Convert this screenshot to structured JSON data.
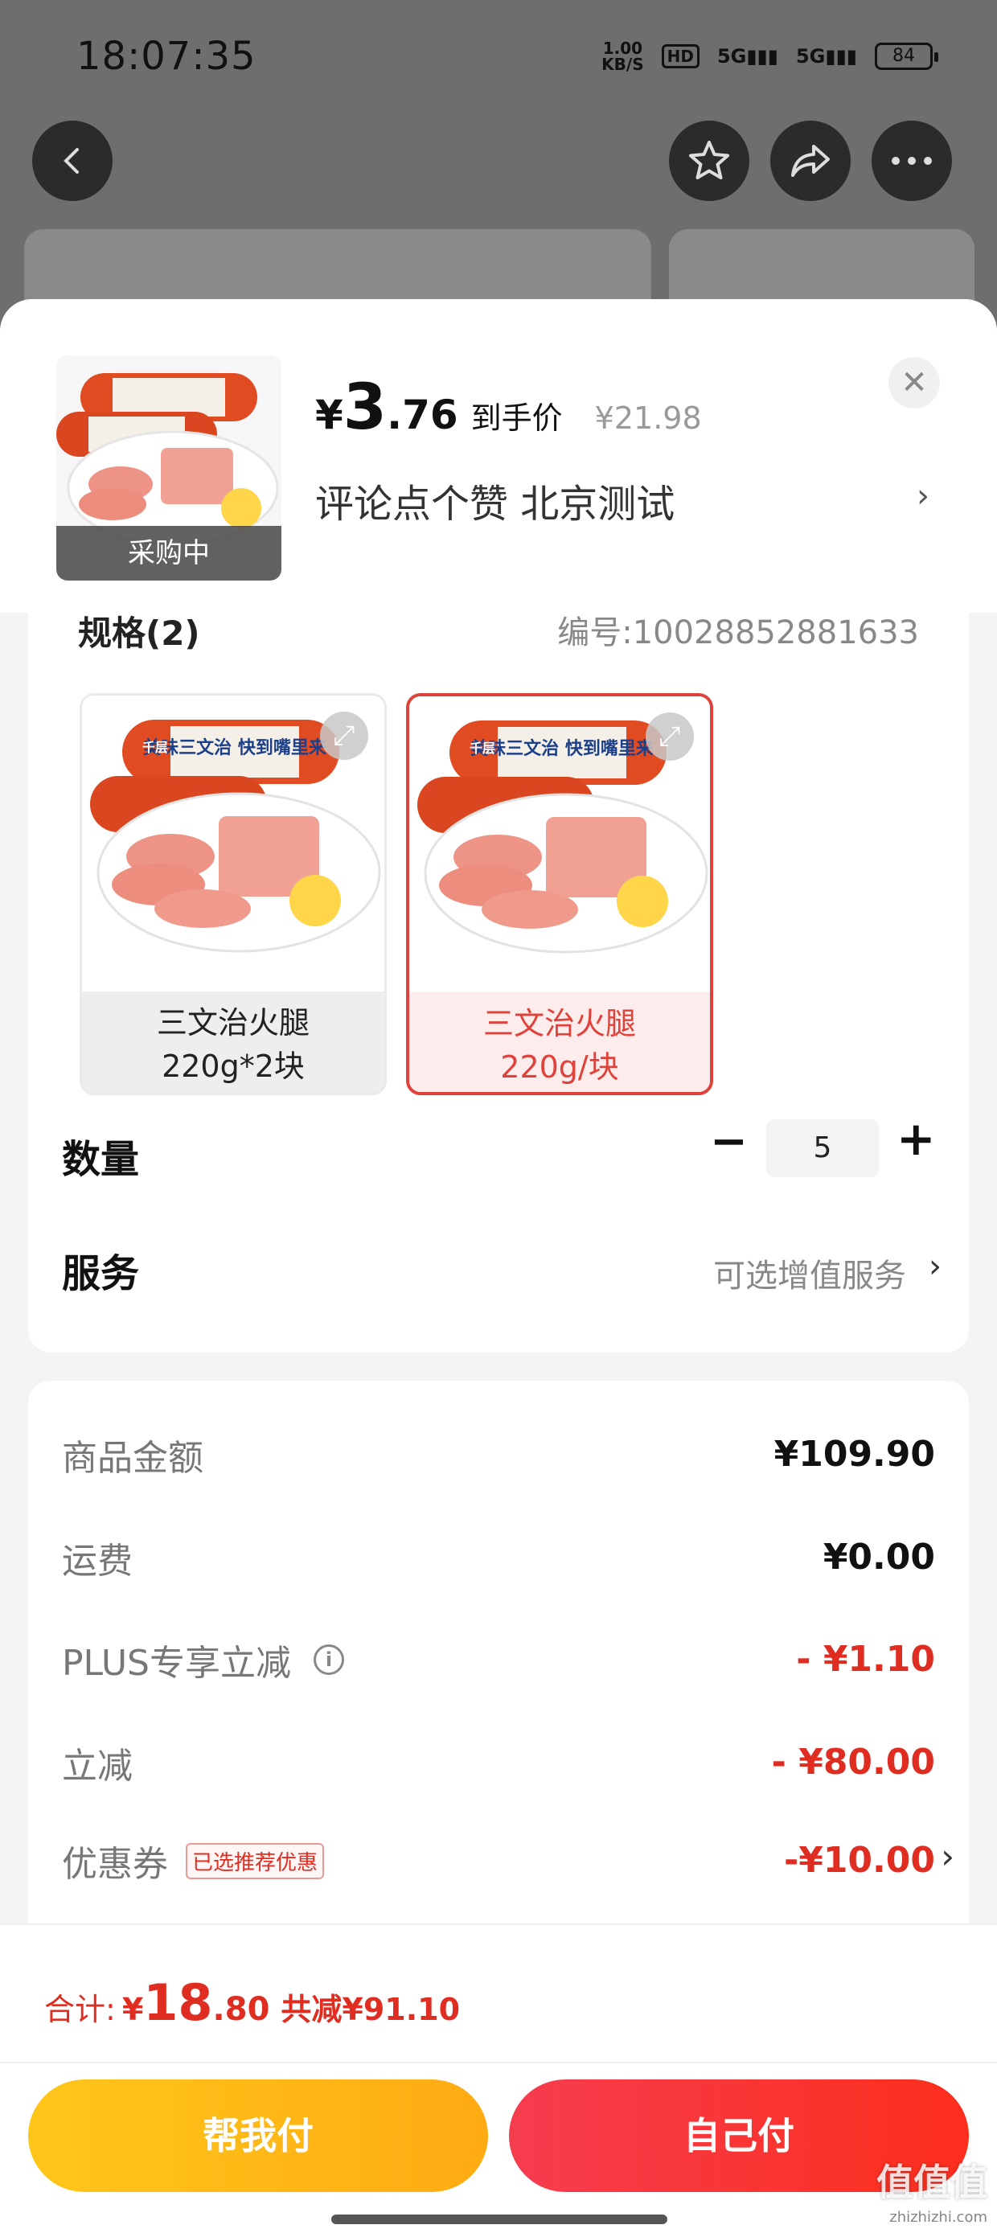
{
  "status_bar": {
    "time": "18:07:35",
    "net_speed_value": "1.00",
    "net_speed_unit": "KB/S",
    "hd_badge": "HD",
    "signal1": "5G",
    "signal2": "5G",
    "battery": "84"
  },
  "background": {
    "back_icon": "chevron-left-icon",
    "star_icon": "star-icon",
    "share_icon": "share-icon",
    "more_icon": "more-dots-icon"
  },
  "product": {
    "thumbnail_tag": "采购中",
    "currency": "¥",
    "price_int": "3",
    "price_dec": ".76",
    "price_label": "到手价",
    "original_price": "¥21.98",
    "address": "评论点个赞  北京测试"
  },
  "spec": {
    "title": "规格(2)",
    "code": "编号:10028852881633",
    "options": [
      {
        "line1": "三文治火腿",
        "line2": "220g*2块",
        "selected": false
      },
      {
        "line1": "三文治火腿",
        "line2": "220g/块",
        "selected": true
      }
    ],
    "package_brand": "千层",
    "package_text": "美味三文治 快到嘴里来"
  },
  "quantity": {
    "label": "数量",
    "value": "5",
    "minus": "−",
    "plus": "+"
  },
  "service": {
    "label": "服务",
    "hint": "可选增值服务"
  },
  "amounts": [
    {
      "label": "商品金额",
      "value": "¥109.90",
      "red": false
    },
    {
      "label": "运费",
      "value": "¥0.00",
      "red": false
    },
    {
      "label": "PLUS专享立减",
      "value": "- ¥1.10",
      "red": true,
      "info_icon": "info-icon"
    },
    {
      "label": "立减",
      "value": "- ¥80.00",
      "red": true
    },
    {
      "label": "优惠券",
      "value": "-¥10.00",
      "red": true,
      "tag": "已选推荐优惠"
    }
  ],
  "footer": {
    "total_label": "合计:",
    "total_currency": "¥",
    "total_int": "18",
    "total_dec": ".80",
    "saved": "共减¥91.10",
    "help_pay": "帮我付",
    "self_pay": "自己付"
  },
  "watermark": {
    "main": "值值值",
    "sub": "zhizhizhi.com"
  },
  "colors": {
    "accent_red": "#e02d22",
    "help_yellow": "#ffc61a",
    "self_red": "#f63d4f"
  }
}
